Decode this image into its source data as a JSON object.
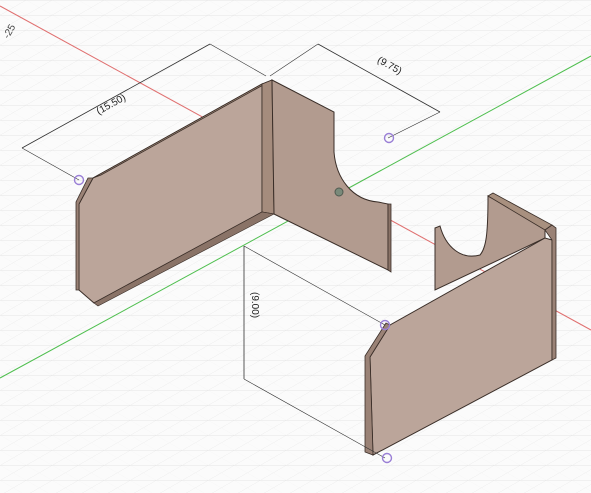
{
  "viewport": {
    "axis_label": "-25",
    "colors": {
      "background": "#fbfbfb",
      "grid": "#dcdcdc",
      "x_axis": "#e07070",
      "y_axis": "#4fbf4f",
      "part_face": "#bba59a",
      "part_face_dark": "#9a8276",
      "part_edge": "#3a2e28",
      "dimension_line": "#303030",
      "sketch_point": "#9a7fd6"
    }
  },
  "dimensions": [
    {
      "id": "width",
      "label": "(15.50)"
    },
    {
      "id": "depth",
      "label": "(9.75)"
    },
    {
      "id": "height",
      "label": "(9.00)"
    }
  ]
}
